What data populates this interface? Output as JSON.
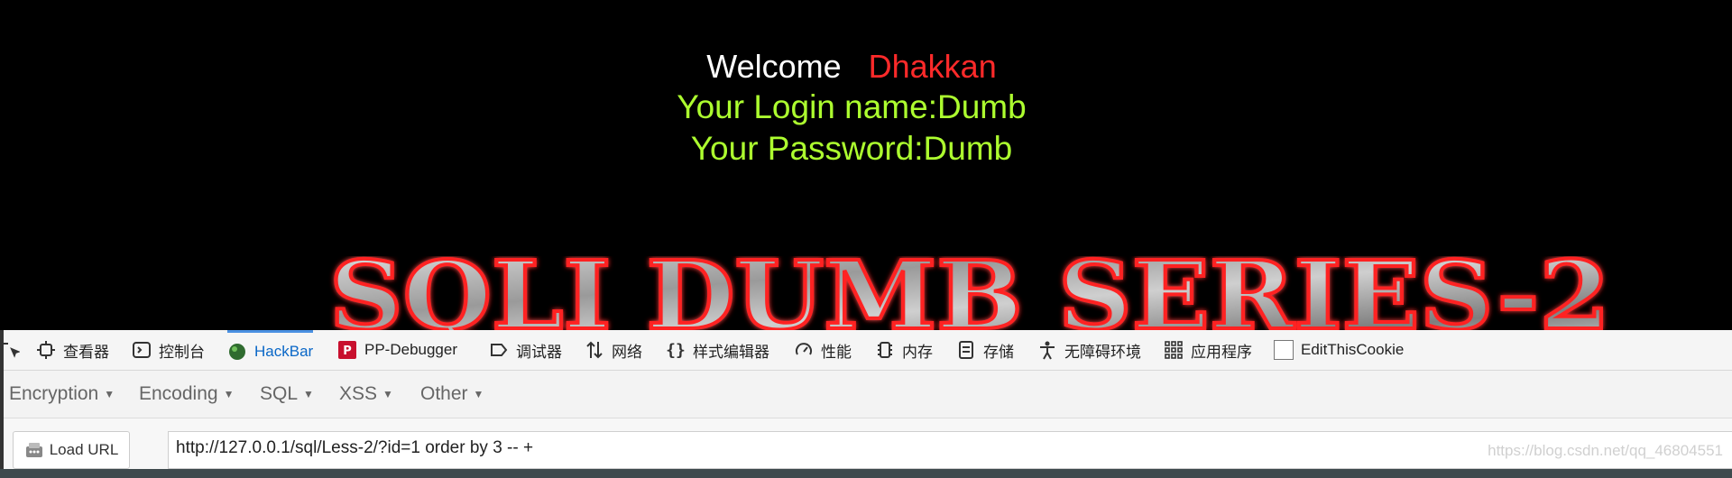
{
  "webpage": {
    "welcome": "Welcome",
    "name": "Dhakkan",
    "login_line": "Your Login name:Dumb",
    "password_line": "Your Password:Dumb",
    "banner_text": "SQLI DUMB SERIES-2"
  },
  "devtools": {
    "tabs": [
      "查看器",
      "控制台",
      "HackBar",
      "PP-Debugger",
      "调试器",
      "网络",
      "样式编辑器",
      "性能",
      "内存",
      "存储",
      "无障碍环境",
      "应用程序",
      "EditThisCookie"
    ],
    "active_tab": "HackBar",
    "colors": {
      "active": "#0a67c7",
      "accent_bar": "#4a90e2"
    }
  },
  "hackbar": {
    "menus": [
      "Encryption",
      "Encoding",
      "SQL",
      "XSS",
      "Other"
    ],
    "load_url_label": "Load URL",
    "url_value": "http://127.0.0.1/sql/Less-2/?id=1 order by 3 -- +"
  },
  "watermark": "https://blog.csdn.net/qq_46804551",
  "colors": {
    "background": "#000000",
    "welcome": "#ffffff",
    "name": "#ff2a2a",
    "green": "#adff2f"
  }
}
